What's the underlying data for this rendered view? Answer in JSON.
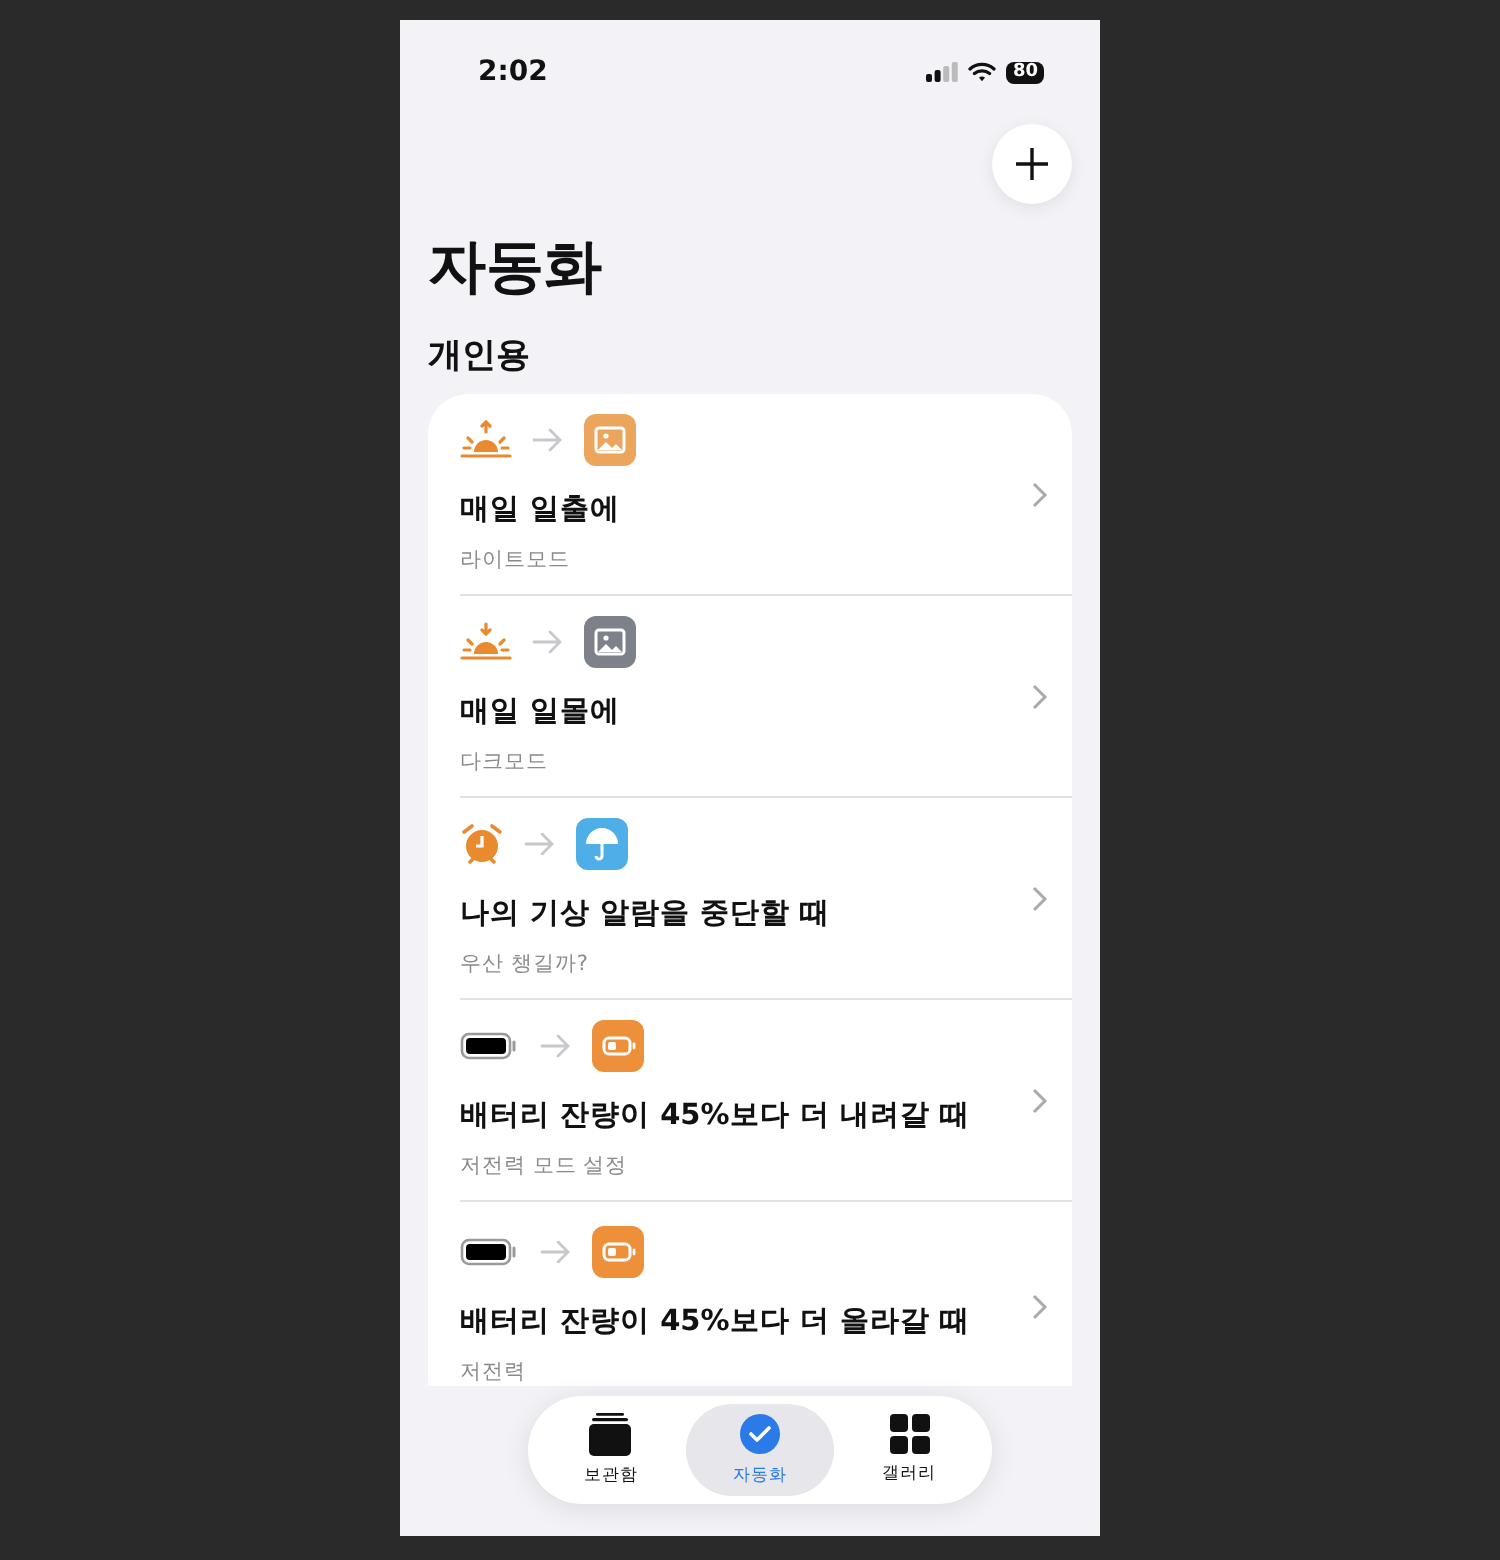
{
  "status_bar": {
    "time": "2:02",
    "battery": "80"
  },
  "title": "자동화",
  "section": "개인용",
  "automations": [
    {
      "trigger": {
        "kind": "sunrise"
      },
      "action": {
        "kind": "light"
      },
      "title": "매일 일출에",
      "subtitle": "라이트모드"
    },
    {
      "trigger": {
        "kind": "sunset"
      },
      "action": {
        "kind": "dark"
      },
      "title": "매일 일몰에",
      "subtitle": "다크모드"
    },
    {
      "trigger": {
        "kind": "alarm"
      },
      "action": {
        "kind": "umbrella"
      },
      "title": "나의 기상 알람을 중단할 때",
      "subtitle": "우산 챙길까?"
    },
    {
      "trigger": {
        "kind": "battery"
      },
      "action": {
        "kind": "lowpower"
      },
      "title": "배터리 잔량이 45%보다 더 내려갈 때",
      "subtitle": "저전력 모드 설정"
    },
    {
      "trigger": {
        "kind": "battery"
      },
      "action": {
        "kind": "lowpower"
      },
      "title": "배터리 잔량이 45%보다 더 올라갈 때",
      "subtitle": "저전력"
    }
  ],
  "tabs": [
    {
      "kind": "library",
      "label": "보관함",
      "selected": false
    },
    {
      "kind": "automation",
      "label": "자동화",
      "selected": true
    },
    {
      "kind": "gallery",
      "label": "갤러리",
      "selected": false
    }
  ]
}
